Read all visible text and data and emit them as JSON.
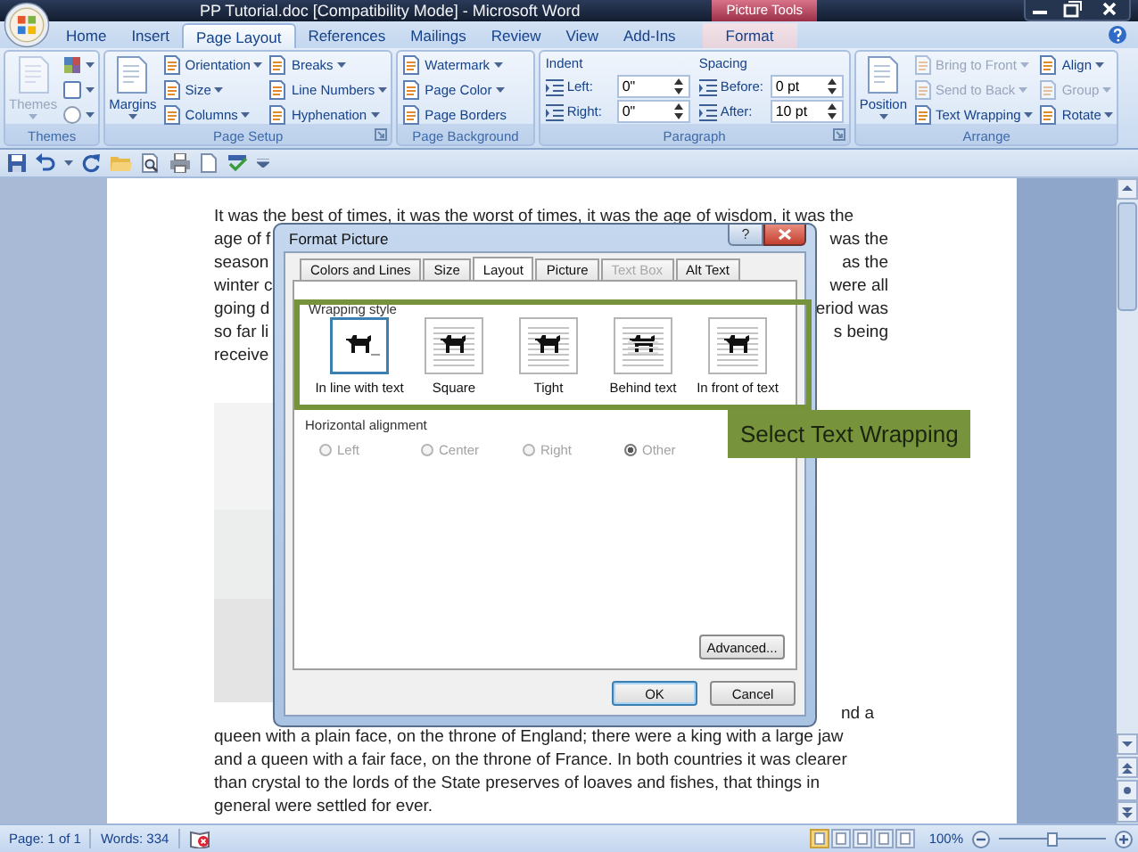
{
  "window": {
    "title": "PP Tutorial.doc [Compatibility Mode] - Microsoft Word",
    "context_label": "Picture Tools"
  },
  "tabs": [
    {
      "label": "Home",
      "selected": false,
      "contextual": false
    },
    {
      "label": "Insert",
      "selected": false,
      "contextual": false
    },
    {
      "label": "Page Layout",
      "selected": true,
      "contextual": false
    },
    {
      "label": "References",
      "selected": false,
      "contextual": false
    },
    {
      "label": "Mailings",
      "selected": false,
      "contextual": false
    },
    {
      "label": "Review",
      "selected": false,
      "contextual": false
    },
    {
      "label": "View",
      "selected": false,
      "contextual": false
    },
    {
      "label": "Add-Ins",
      "selected": false,
      "contextual": false
    },
    {
      "label": "Format",
      "selected": false,
      "contextual": true
    }
  ],
  "ribbon": [
    {
      "kind": "buttons",
      "label": "Themes",
      "launcher": false,
      "columns": [
        [
          {
            "kind": "big",
            "label": "Themes",
            "disabled": true,
            "dropdown": true
          }
        ],
        [
          {
            "kind": "icon",
            "disabled": false,
            "dropdown": true
          },
          {
            "kind": "icon",
            "disabled": false,
            "dropdown": true
          },
          {
            "kind": "icon",
            "disabled": false,
            "dropdown": true
          }
        ]
      ]
    },
    {
      "kind": "buttons",
      "label": "Page Setup",
      "launcher": true,
      "columns": [
        [
          {
            "kind": "big",
            "label": "Margins",
            "disabled": false,
            "dropdown": true
          }
        ],
        [
          {
            "kind": "small",
            "label": "Orientation",
            "disabled": false,
            "dropdown": true
          },
          {
            "kind": "small",
            "label": "Size",
            "disabled": false,
            "dropdown": true
          },
          {
            "kind": "small",
            "label": "Columns",
            "disabled": false,
            "dropdown": true
          }
        ],
        [
          {
            "kind": "small",
            "label": "Breaks",
            "disabled": false,
            "dropdown": true
          },
          {
            "kind": "small",
            "label": "Line Numbers",
            "disabled": false,
            "dropdown": true
          },
          {
            "kind": "small",
            "label": "Hyphenation",
            "disabled": false,
            "dropdown": true
          }
        ]
      ]
    },
    {
      "kind": "buttons",
      "label": "Page Background",
      "launcher": false,
      "columns": [
        [
          {
            "kind": "small",
            "label": "Watermark",
            "disabled": false,
            "dropdown": true
          },
          {
            "kind": "small",
            "label": "Page Color",
            "disabled": false,
            "dropdown": true
          },
          {
            "kind": "small",
            "label": "Page Borders",
            "disabled": false,
            "dropdown": false
          }
        ]
      ]
    },
    {
      "kind": "spinners",
      "label": "Paragraph",
      "launcher": true,
      "sections": [
        {
          "title": "Indent",
          "fields": [
            {
              "label": "Left:",
              "value": "0\""
            },
            {
              "label": "Right:",
              "value": "0\""
            }
          ]
        },
        {
          "title": "Spacing",
          "fields": [
            {
              "label": "Before:",
              "value": "0 pt"
            },
            {
              "label": "After:",
              "value": "10 pt"
            }
          ]
        }
      ]
    },
    {
      "kind": "buttons",
      "label": "Arrange",
      "launcher": false,
      "columns": [
        [
          {
            "kind": "big",
            "label": "Position",
            "disabled": false,
            "dropdown": true
          }
        ],
        [
          {
            "kind": "small",
            "label": "Bring to Front",
            "disabled": true,
            "dropdown": true
          },
          {
            "kind": "small",
            "label": "Send to Back",
            "disabled": true,
            "dropdown": true
          },
          {
            "kind": "small",
            "label": "Text Wrapping",
            "disabled": false,
            "dropdown": true
          }
        ],
        [
          {
            "kind": "small",
            "label": "Align",
            "disabled": false,
            "dropdown": true
          },
          {
            "kind": "small",
            "label": "Group",
            "disabled": true,
            "dropdown": true
          },
          {
            "kind": "small",
            "label": "Rotate",
            "disabled": false,
            "dropdown": true
          }
        ]
      ]
    }
  ],
  "document": {
    "lines_above": [
      {
        "text": "It was the best of times, it was the worst of times, it was the age of wisdom, it was the"
      },
      {
        "left": "age of f",
        "right": "was the"
      },
      {
        "left": "season",
        "right": "as the"
      },
      {
        "left": "winter c",
        "right": "were all"
      },
      {
        "left": "going d",
        "right": "eriod was"
      },
      {
        "left": "so far li",
        "right": "s being"
      },
      {
        "left": "receive"
      }
    ],
    "lines_below": [
      {
        "right": "nd a"
      },
      {
        "text": "queen with a plain face, on the throne of England; there were a king with a large jaw"
      },
      {
        "text": "and a queen with a fair face, on the throne of France. In both countries it was clearer"
      },
      {
        "text": "than crystal to the lords of the State preserves of loaves and fishes, that things in"
      },
      {
        "text": "general were settled for ever."
      }
    ]
  },
  "dialog": {
    "title": "Format Picture",
    "help_label": "?",
    "tabs": [
      {
        "label": "Colors and Lines",
        "selected": false,
        "disabled": false
      },
      {
        "label": "Size",
        "selected": false,
        "disabled": false
      },
      {
        "label": "Layout",
        "selected": true,
        "disabled": false
      },
      {
        "label": "Picture",
        "selected": false,
        "disabled": false
      },
      {
        "label": "Text Box",
        "selected": false,
        "disabled": true
      },
      {
        "label": "Alt Text",
        "selected": false,
        "disabled": false
      }
    ],
    "wrapping": {
      "title": "Wrapping style",
      "options": [
        {
          "label": "In line with text",
          "selected": true
        },
        {
          "label": "Square",
          "selected": false
        },
        {
          "label": "Tight",
          "selected": false
        },
        {
          "label": "Behind text",
          "selected": false
        },
        {
          "label": "In front of text",
          "selected": false
        }
      ]
    },
    "alignment": {
      "title": "Horizontal alignment",
      "options": [
        {
          "label": "Left",
          "selected": false,
          "disabled": true
        },
        {
          "label": "Center",
          "selected": false,
          "disabled": true
        },
        {
          "label": "Right",
          "selected": false,
          "disabled": true
        },
        {
          "label": "Other",
          "selected": true,
          "disabled": true
        }
      ]
    },
    "advanced_label": "Advanced...",
    "ok_label": "OK",
    "cancel_label": "Cancel"
  },
  "callout": {
    "text": "Select Text Wrapping"
  },
  "status_bar": {
    "page": "Page: 1 of 1",
    "words": "Words: 334",
    "views": [
      {
        "selected": true
      },
      {
        "selected": false
      },
      {
        "selected": false
      },
      {
        "selected": false
      },
      {
        "selected": false
      }
    ],
    "zoom": {
      "label": "100%",
      "level": 0.5
    }
  }
}
